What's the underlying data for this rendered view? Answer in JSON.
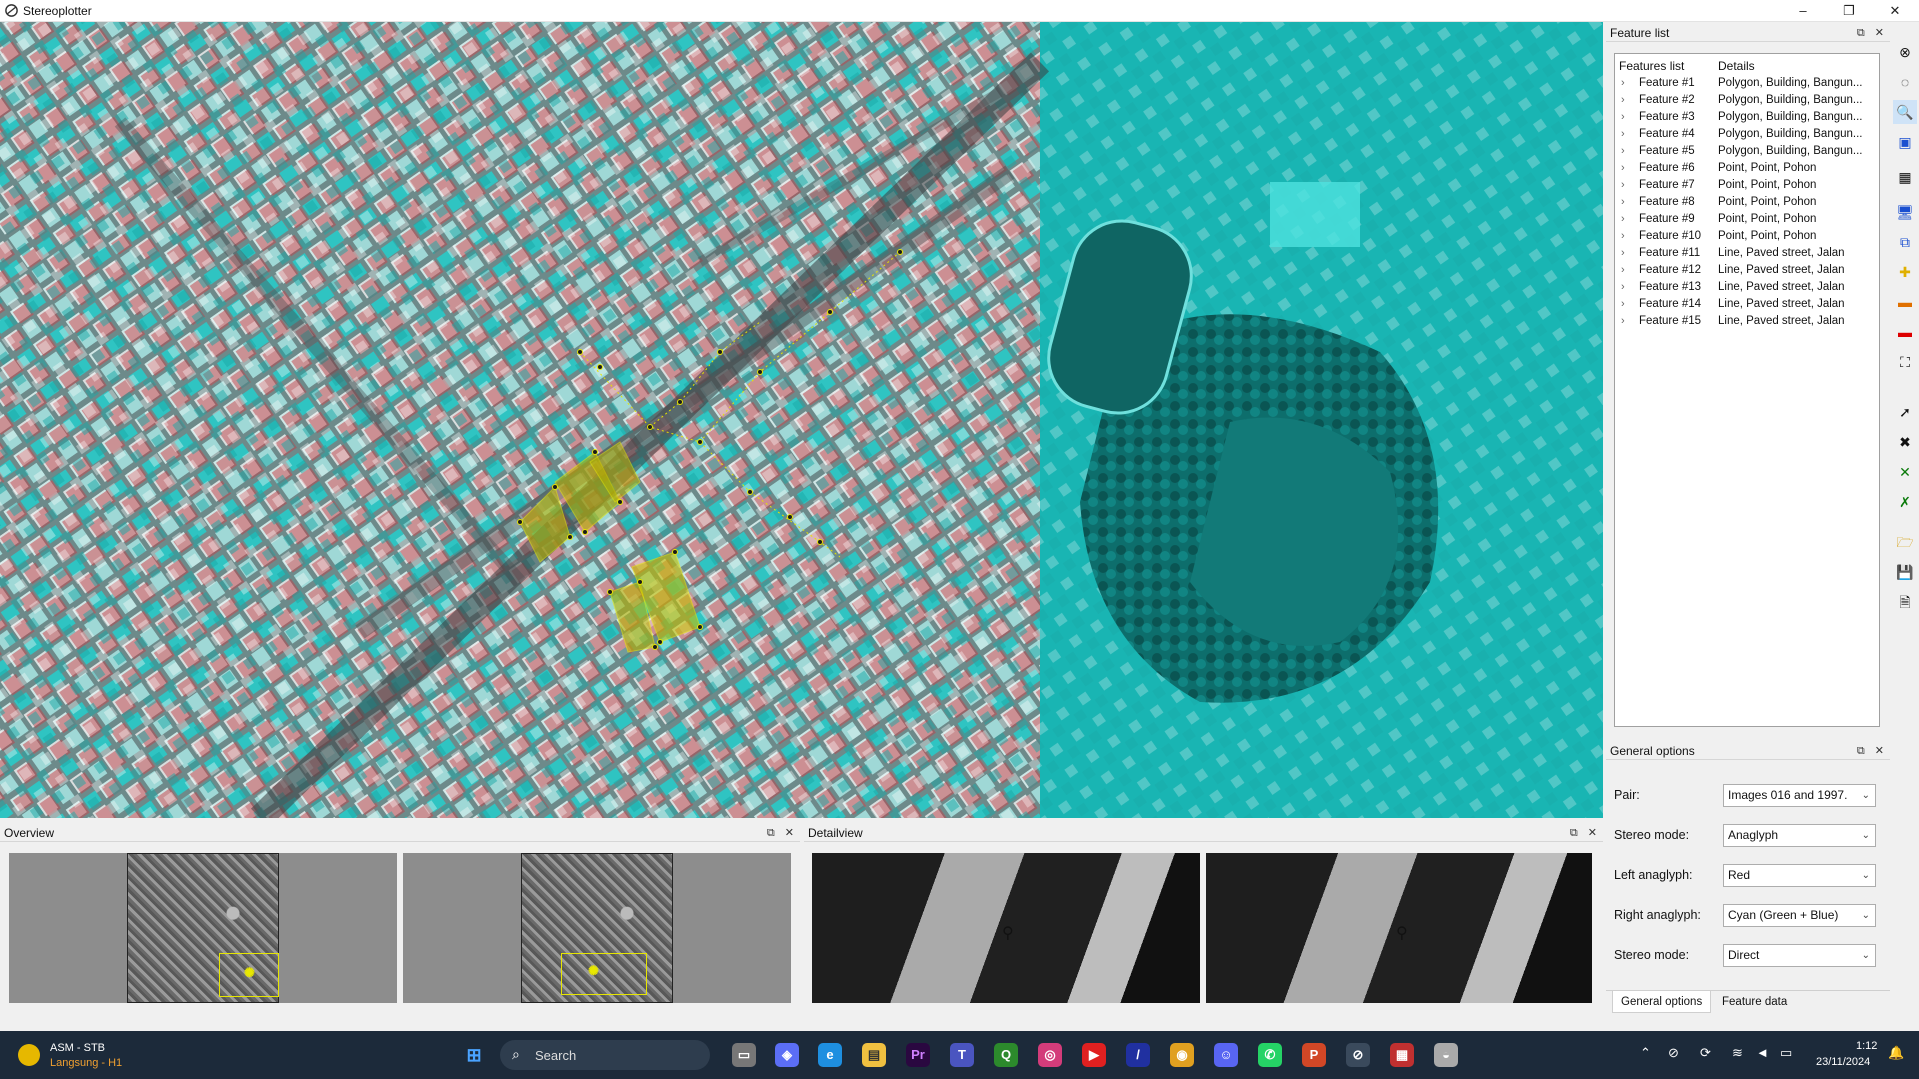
{
  "window": {
    "title": "Stereoplotter",
    "min": "–",
    "restore": "❐",
    "close": "✕"
  },
  "feature_list": {
    "panel_title": "Feature list",
    "col_name": "Features list",
    "col_details": "Details",
    "rows": [
      {
        "name": "Feature #1",
        "details": "Polygon, Building, Bangun..."
      },
      {
        "name": "Feature #2",
        "details": "Polygon, Building, Bangun..."
      },
      {
        "name": "Feature #3",
        "details": "Polygon, Building, Bangun..."
      },
      {
        "name": "Feature #4",
        "details": "Polygon, Building, Bangun..."
      },
      {
        "name": "Feature #5",
        "details": "Polygon, Building, Bangun..."
      },
      {
        "name": "Feature #6",
        "details": "Point, Point, Pohon"
      },
      {
        "name": "Feature #7",
        "details": "Point, Point, Pohon"
      },
      {
        "name": "Feature #8",
        "details": "Point, Point, Pohon"
      },
      {
        "name": "Feature #9",
        "details": "Point, Point, Pohon"
      },
      {
        "name": "Feature #10",
        "details": "Point, Point, Pohon"
      },
      {
        "name": "Feature #11",
        "details": "Line, Paved street, Jalan"
      },
      {
        "name": "Feature #12",
        "details": "Line, Paved street, Jalan"
      },
      {
        "name": "Feature #13",
        "details": "Line, Paved street, Jalan"
      },
      {
        "name": "Feature #14",
        "details": "Line, Paved street, Jalan"
      },
      {
        "name": "Feature #15",
        "details": "Line, Paved street, Jalan"
      }
    ]
  },
  "general_options": {
    "panel_title": "General options",
    "fields": [
      {
        "label": "Pair:",
        "value": "Images 016 and 1997."
      },
      {
        "label": "Stereo mode:",
        "value": "Anaglyph"
      },
      {
        "label": "Left anaglyph:",
        "value": "Red"
      },
      {
        "label": "Right anaglyph:",
        "value": "Cyan (Green + Blue)"
      },
      {
        "label": "Stereo mode:",
        "value": "Direct"
      }
    ],
    "tabs": [
      "General options",
      "Feature data"
    ]
  },
  "overview": {
    "title": "Overview"
  },
  "detailview": {
    "title": "Detailview"
  },
  "taskbar": {
    "weather_title": "ASM - STB",
    "weather_sub": "Langsung - H1",
    "search_placeholder": "Search",
    "time": "1:12",
    "date": "23/11/2024"
  },
  "colors": {
    "anaglyph_red": "#d8424a",
    "anaglyph_cyan": "#19c7c5",
    "feature_yellow": "#e6e600",
    "taskbar": "#1c2a3a"
  }
}
